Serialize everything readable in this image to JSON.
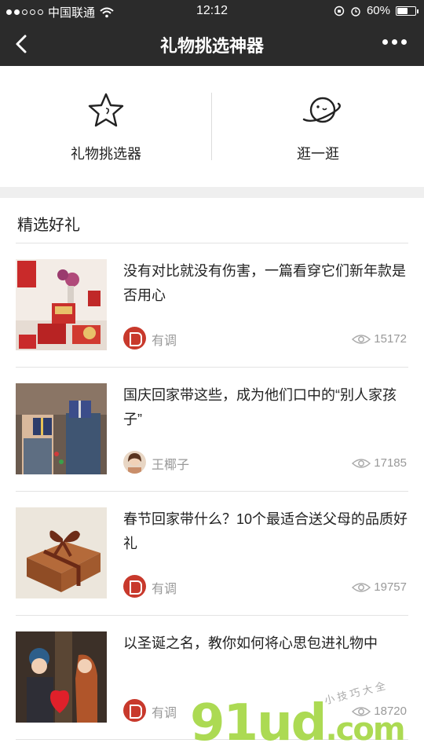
{
  "status_bar": {
    "carrier": "中国联通",
    "time": "12:12",
    "battery": "60%",
    "battery_level": 0.6
  },
  "nav": {
    "title": "礼物挑选神器"
  },
  "entries": [
    {
      "label": "礼物挑选器",
      "icon": "star-icon"
    },
    {
      "label": "逛一逛",
      "icon": "planet-icon"
    }
  ],
  "section": {
    "title": "精选好礼"
  },
  "articles": [
    {
      "title": "没有对比就没有伤害，一篇看穿它们新年款是否用心",
      "author": "有调",
      "views": "15172"
    },
    {
      "title": "国庆回家带这些，成为他们口中的“别人家孩子”",
      "author": "王椰子",
      "views": "17185"
    },
    {
      "title": "春节回家带什么？10个最适合送父母的品质好礼",
      "author": "有调",
      "views": "19757"
    },
    {
      "title": "以圣诞之名，教你如何将心思包进礼物中",
      "author": "有调",
      "views": "18720"
    }
  ],
  "watermark": {
    "main": "91ud",
    "suffix": ".com",
    "sub": "小 技 巧 大 全"
  },
  "colors": {
    "nav_bg": "#2b2b2b",
    "brand_red": "#c8392c",
    "watermark_green": "#a8d94a"
  }
}
